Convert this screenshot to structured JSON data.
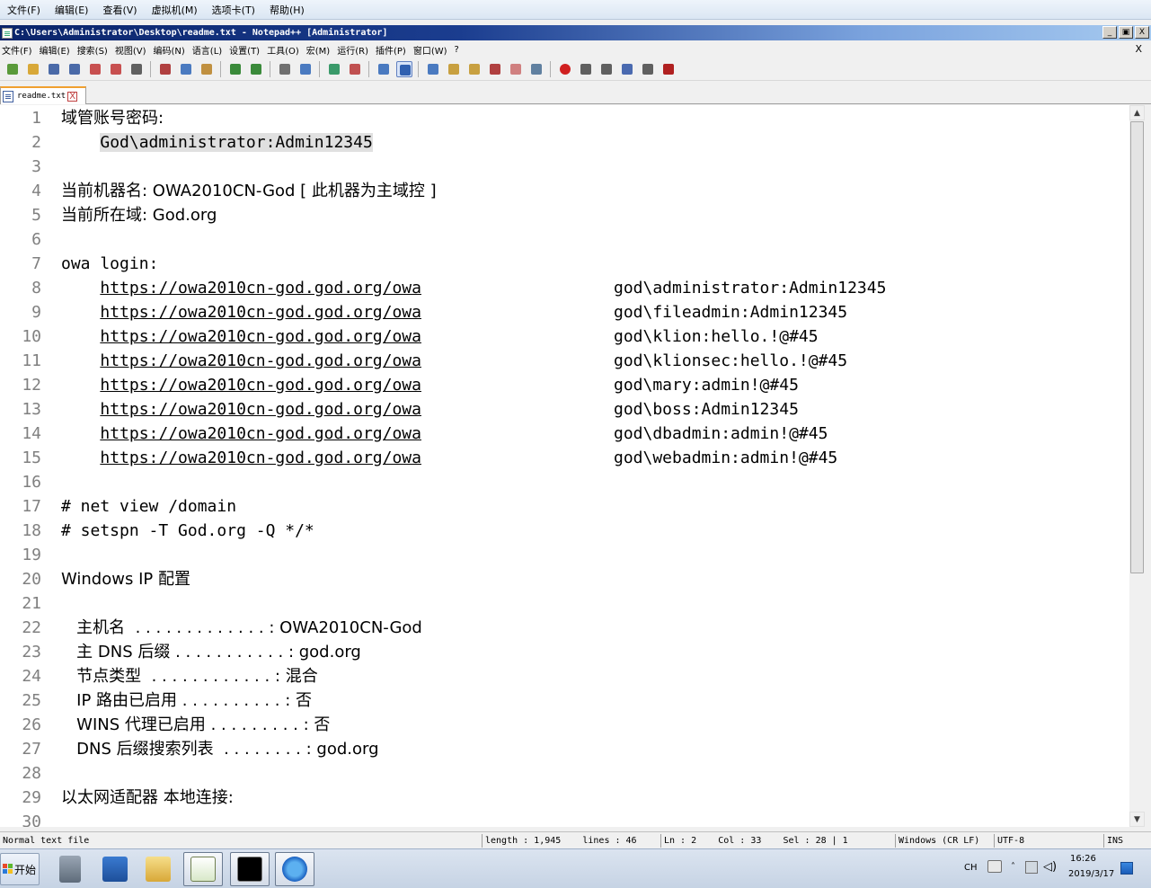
{
  "vm_menu": [
    "文件(F)",
    "编辑(E)",
    "查看(V)",
    "虚拟机(M)",
    "选项卡(T)",
    "帮助(H)"
  ],
  "window": {
    "title": "C:\\Users\\Administrator\\Desktop\\readme.txt - Notepad++ [Administrator]",
    "buttons": [
      "_",
      "▣",
      "X"
    ]
  },
  "app_menu": [
    "文件(F)",
    "编辑(E)",
    "搜索(S)",
    "视图(V)",
    "编码(N)",
    "语言(L)",
    "设置(T)",
    "工具(O)",
    "宏(M)",
    "运行(R)",
    "插件(P)",
    "窗口(W)",
    "?"
  ],
  "app_menu_close": "X",
  "toolbar_icons": [
    "new-file-icon",
    "open-file-icon",
    "save-icon",
    "save-all-icon",
    "close-icon",
    "close-all-icon",
    "print-icon",
    "cut-icon",
    "copy-icon",
    "paste-icon",
    "undo-icon",
    "redo-icon",
    "find-icon",
    "replace-icon",
    "zoom-in-icon",
    "zoom-out-icon",
    "sync-scroll-icon",
    "word-wrap-icon",
    "show-all-chars-icon",
    "indent-guide-icon",
    "doc-map-icon",
    "function-list-icon",
    "folder-workspace-icon",
    "monitoring-icon",
    "record-macro-icon",
    "stop-macro-icon",
    "play-macro-icon",
    "run-macro-multiple-icon",
    "save-macro-icon",
    "spell-check-icon"
  ],
  "tab": {
    "label": "readme.txt",
    "close": "X"
  },
  "editor": {
    "lines": [
      {
        "n": "1",
        "text": "域管账号密码:"
      },
      {
        "n": "2",
        "indent": "    ",
        "text": "God\\administrator:Admin12345",
        "selected": true
      },
      {
        "n": "3",
        "text": ""
      },
      {
        "n": "4",
        "text": "当前机器名: OWA2010CN-God [ 此机器为主域控 ]"
      },
      {
        "n": "5",
        "text": "当前所在域: God.org"
      },
      {
        "n": "6",
        "text": ""
      },
      {
        "n": "7",
        "text": "owa login:"
      },
      {
        "n": "8",
        "url": "https://owa2010cn-god.god.org/owa",
        "cred": "god\\administrator:Admin12345"
      },
      {
        "n": "9",
        "url": "https://owa2010cn-god.god.org/owa",
        "cred": "god\\fileadmin:Admin12345"
      },
      {
        "n": "10",
        "url": "https://owa2010cn-god.god.org/owa",
        "cred": "god\\klion:hello.!@#45"
      },
      {
        "n": "11",
        "url": "https://owa2010cn-god.god.org/owa",
        "cred": "god\\klionsec:hello.!@#45"
      },
      {
        "n": "12",
        "url": "https://owa2010cn-god.god.org/owa",
        "cred": "god\\mary:admin!@#45"
      },
      {
        "n": "13",
        "url": "https://owa2010cn-god.god.org/owa",
        "cred": "god\\boss:Admin12345"
      },
      {
        "n": "14",
        "url": "https://owa2010cn-god.god.org/owa",
        "cred": "god\\dbadmin:admin!@#45"
      },
      {
        "n": "15",
        "url": "https://owa2010cn-god.god.org/owa",
        "cred": "god\\webadmin:admin!@#45"
      },
      {
        "n": "16",
        "text": ""
      },
      {
        "n": "17",
        "text": "# net view /domain"
      },
      {
        "n": "18",
        "text": "# setspn -T God.org -Q */*"
      },
      {
        "n": "19",
        "text": ""
      },
      {
        "n": "20",
        "text": "Windows IP 配置"
      },
      {
        "n": "21",
        "text": ""
      },
      {
        "n": "22",
        "text": "   主机名  . . . . . . . . . . . . . : OWA2010CN-God"
      },
      {
        "n": "23",
        "text": "   主 DNS 后缀 . . . . . . . . . . . : god.org"
      },
      {
        "n": "24",
        "text": "   节点类型  . . . . . . . . . . . . : 混合"
      },
      {
        "n": "25",
        "text": "   IP 路由已启用 . . . . . . . . . . : 否"
      },
      {
        "n": "26",
        "text": "   WINS 代理已启用 . . . . . . . . . : 否"
      },
      {
        "n": "27",
        "text": "   DNS 后缀搜索列表  . . . . . . . . : god.org"
      },
      {
        "n": "28",
        "text": ""
      },
      {
        "n": "29",
        "text": "以太网适配器 本地连接:"
      },
      {
        "n": "30",
        "text": ""
      }
    ]
  },
  "status": {
    "type": "Normal text file",
    "length": "length : 1,945    lines : 46",
    "pos": "Ln : 2    Col : 33    Sel : 28 | 1",
    "eol": "Windows (CR LF)",
    "enc": "UTF-8",
    "mode": "INS"
  },
  "taskbar": {
    "start": "开始",
    "apps": [
      "server-manager-icon",
      "powershell-icon",
      "explorer-icon",
      "notepadpp-icon",
      "cmd-icon",
      "ie-icon"
    ],
    "lang": "CH",
    "time": "16:26",
    "date": "2019/3/17"
  }
}
